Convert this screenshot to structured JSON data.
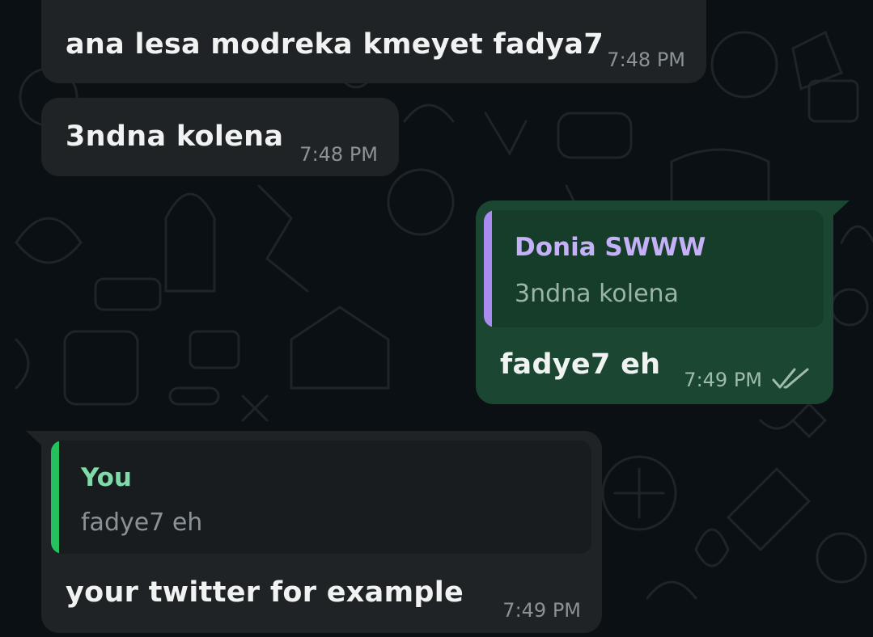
{
  "messages": [
    {
      "direction": "incoming",
      "text": "ana lesa modreka kmeyet fadya7",
      "time": "7:48 PM"
    },
    {
      "direction": "incoming",
      "text": "3ndna kolena",
      "time": "7:48 PM"
    },
    {
      "direction": "outgoing",
      "quote": {
        "author": "Donia SWWW",
        "text": "3ndna kolena"
      },
      "text": "fadye7 eh",
      "time": "7:49 PM",
      "status_icon": "double-check-icon"
    },
    {
      "direction": "incoming",
      "quote": {
        "author": "You",
        "text": "fadye7 eh"
      },
      "text": "your twitter for example",
      "time": "7:49 PM"
    }
  ],
  "colors": {
    "background": "#0b1014",
    "incoming_bubble": "#1f2326",
    "outgoing_bubble": "#1b4631",
    "quote_author_outgoing": "#c5b1f7",
    "quote_bar_outgoing": "#a98cf0",
    "quote_author_incoming": "#7fdba7",
    "quote_bar_incoming": "#25c15f"
  }
}
